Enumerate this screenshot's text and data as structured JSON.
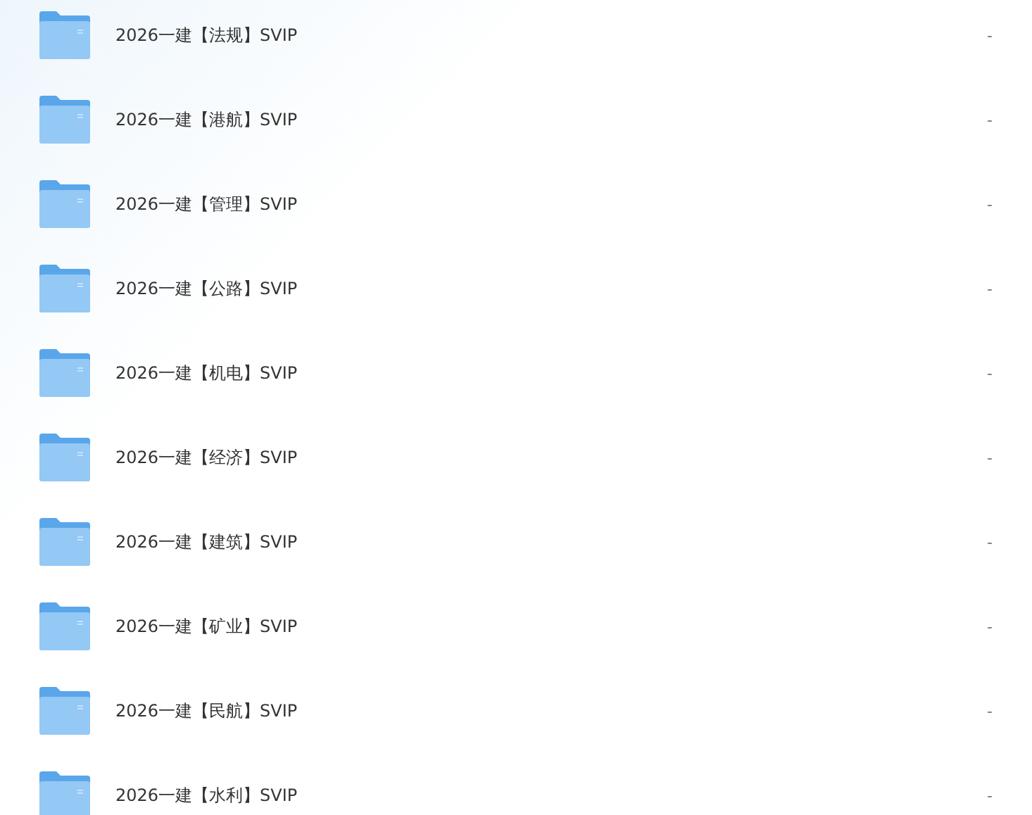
{
  "files": [
    {
      "name": "2026一建【法规】SVIP",
      "size": "-"
    },
    {
      "name": "2026一建【港航】SVIP",
      "size": "-"
    },
    {
      "name": "2026一建【管理】SVIP",
      "size": "-"
    },
    {
      "name": "2026一建【公路】SVIP",
      "size": "-"
    },
    {
      "name": "2026一建【机电】SVIP",
      "size": "-"
    },
    {
      "name": "2026一建【经济】SVIP",
      "size": "-"
    },
    {
      "name": "2026一建【建筑】SVIP",
      "size": "-"
    },
    {
      "name": "2026一建【矿业】SVIP",
      "size": "-"
    },
    {
      "name": "2026一建【民航】SVIP",
      "size": "-"
    },
    {
      "name": "2026一建【水利】SVIP",
      "size": "-"
    }
  ]
}
